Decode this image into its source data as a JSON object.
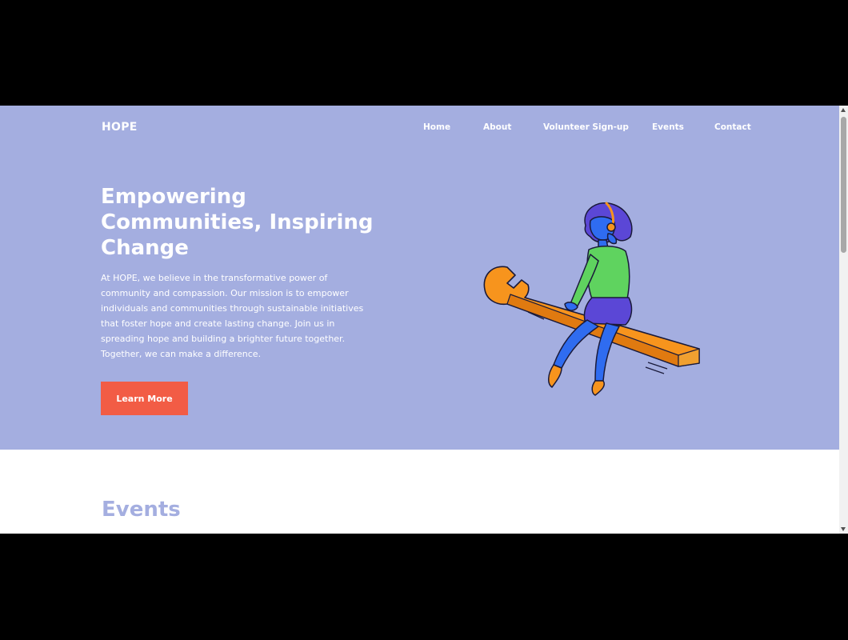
{
  "brand": {
    "logo": "HOPE"
  },
  "nav": {
    "items": [
      "Home",
      "About",
      "Volunteer Sign-up",
      "Events",
      "Contact"
    ]
  },
  "hero": {
    "title": "Empowering Communities, Inspiring Change",
    "description": "At HOPE, we believe in the transformative power of community and compassion. Our mission is to empower individuals and communities through sustainable initiatives that foster hope and create lasting change. Join us in spreading hope and building a brighter future together. Together, we can make a difference.",
    "cta_label": "Learn More",
    "illustration": "woman-sitting-on-wrench-illustration"
  },
  "events": {
    "title": "Events"
  },
  "colors": {
    "hero_bg": "#a4aee0",
    "accent": "#f25c45",
    "illustration_orange": "#f7941d",
    "illustration_blue": "#2f6cf0",
    "illustration_green": "#5fd35f",
    "illustration_purple": "#5b47d6"
  }
}
